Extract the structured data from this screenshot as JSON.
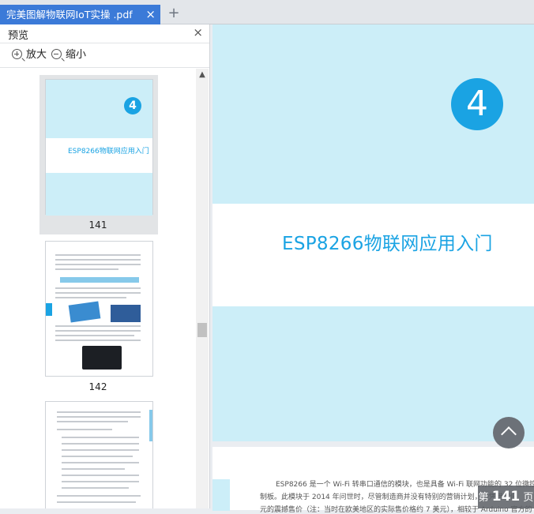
{
  "tab": {
    "title": "完美图解物联网IoT实操 .pdf",
    "close": "×",
    "new": "+"
  },
  "preview": {
    "title": "预览",
    "close": "×",
    "zoom_in": "放大",
    "zoom_out": "缩小",
    "thumbnails": [
      {
        "page": "141",
        "chapter_num": "4",
        "chapter_title": "ESP8266物联网应用入门"
      },
      {
        "page": "142"
      }
    ]
  },
  "document": {
    "chapter_num": "4",
    "chapter_title": "ESP8266物联网应用入门",
    "body_line1": "ESP8266 是一个 Wi-Fi 转串口通信的模块，也是具备 Wi-Fi 联网功能的 32 位微控",
    "body_line2": "制板。此模块于 2014 年问世时，尽管制造商并没有特别的营销计划，但凭借超低",
    "body_line3": "元的震撼售价（注：当时在欧美地区的实际售价格约 7 美元），相较于 Arduino 官方的"
  },
  "page_indicator": {
    "prefix": "第",
    "number": "141",
    "suffix": "页"
  },
  "colors": {
    "accent": "#1aa3e3",
    "tab": "#3b7ad8",
    "band": "#cceef8"
  }
}
